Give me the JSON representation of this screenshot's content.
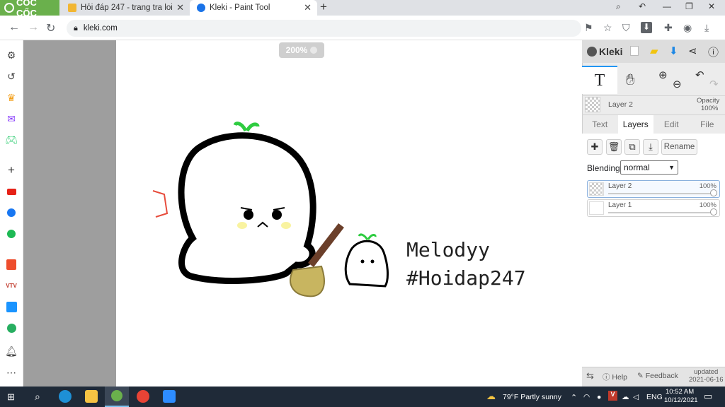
{
  "browser": {
    "brand": "CỐC CỐC",
    "tabs": [
      {
        "title": "Hỏi đáp 247 - trang tra loi",
        "active": false
      },
      {
        "title": "Kleki - Paint Tool",
        "active": true
      }
    ],
    "new_tab": "+",
    "url": "kleki.com"
  },
  "canvas": {
    "zoom": "200%",
    "drawing_text": [
      "Melodyy",
      "#Hoidap247"
    ]
  },
  "kleki": {
    "logo": "Kleki",
    "current_layer": "Layer 2",
    "opacity_label": "Opacity",
    "opacity_value": "100%",
    "tabs": [
      "Text",
      "Layers",
      "Edit",
      "File"
    ],
    "active_tab": "Layers",
    "rename_label": "Rename",
    "blending_label": "Blending",
    "blending_value": "normal",
    "layers": [
      {
        "name": "Layer 2",
        "opacity": "100%",
        "selected": true
      },
      {
        "name": "Layer 1",
        "opacity": "100%",
        "selected": false
      }
    ],
    "footer": {
      "help": "Help",
      "feedback": "Feedback",
      "updated_label": "updated",
      "updated_date": "2021-06-16"
    }
  },
  "taskbar": {
    "weather": "79°F  Partly sunny",
    "language": "ENG",
    "time": "10:52 AM",
    "date": "10/12/2021"
  },
  "colors": {
    "brand_green": "#6ab04c",
    "accent_blue": "#2196f3",
    "taskbar": "#1f2a38"
  }
}
